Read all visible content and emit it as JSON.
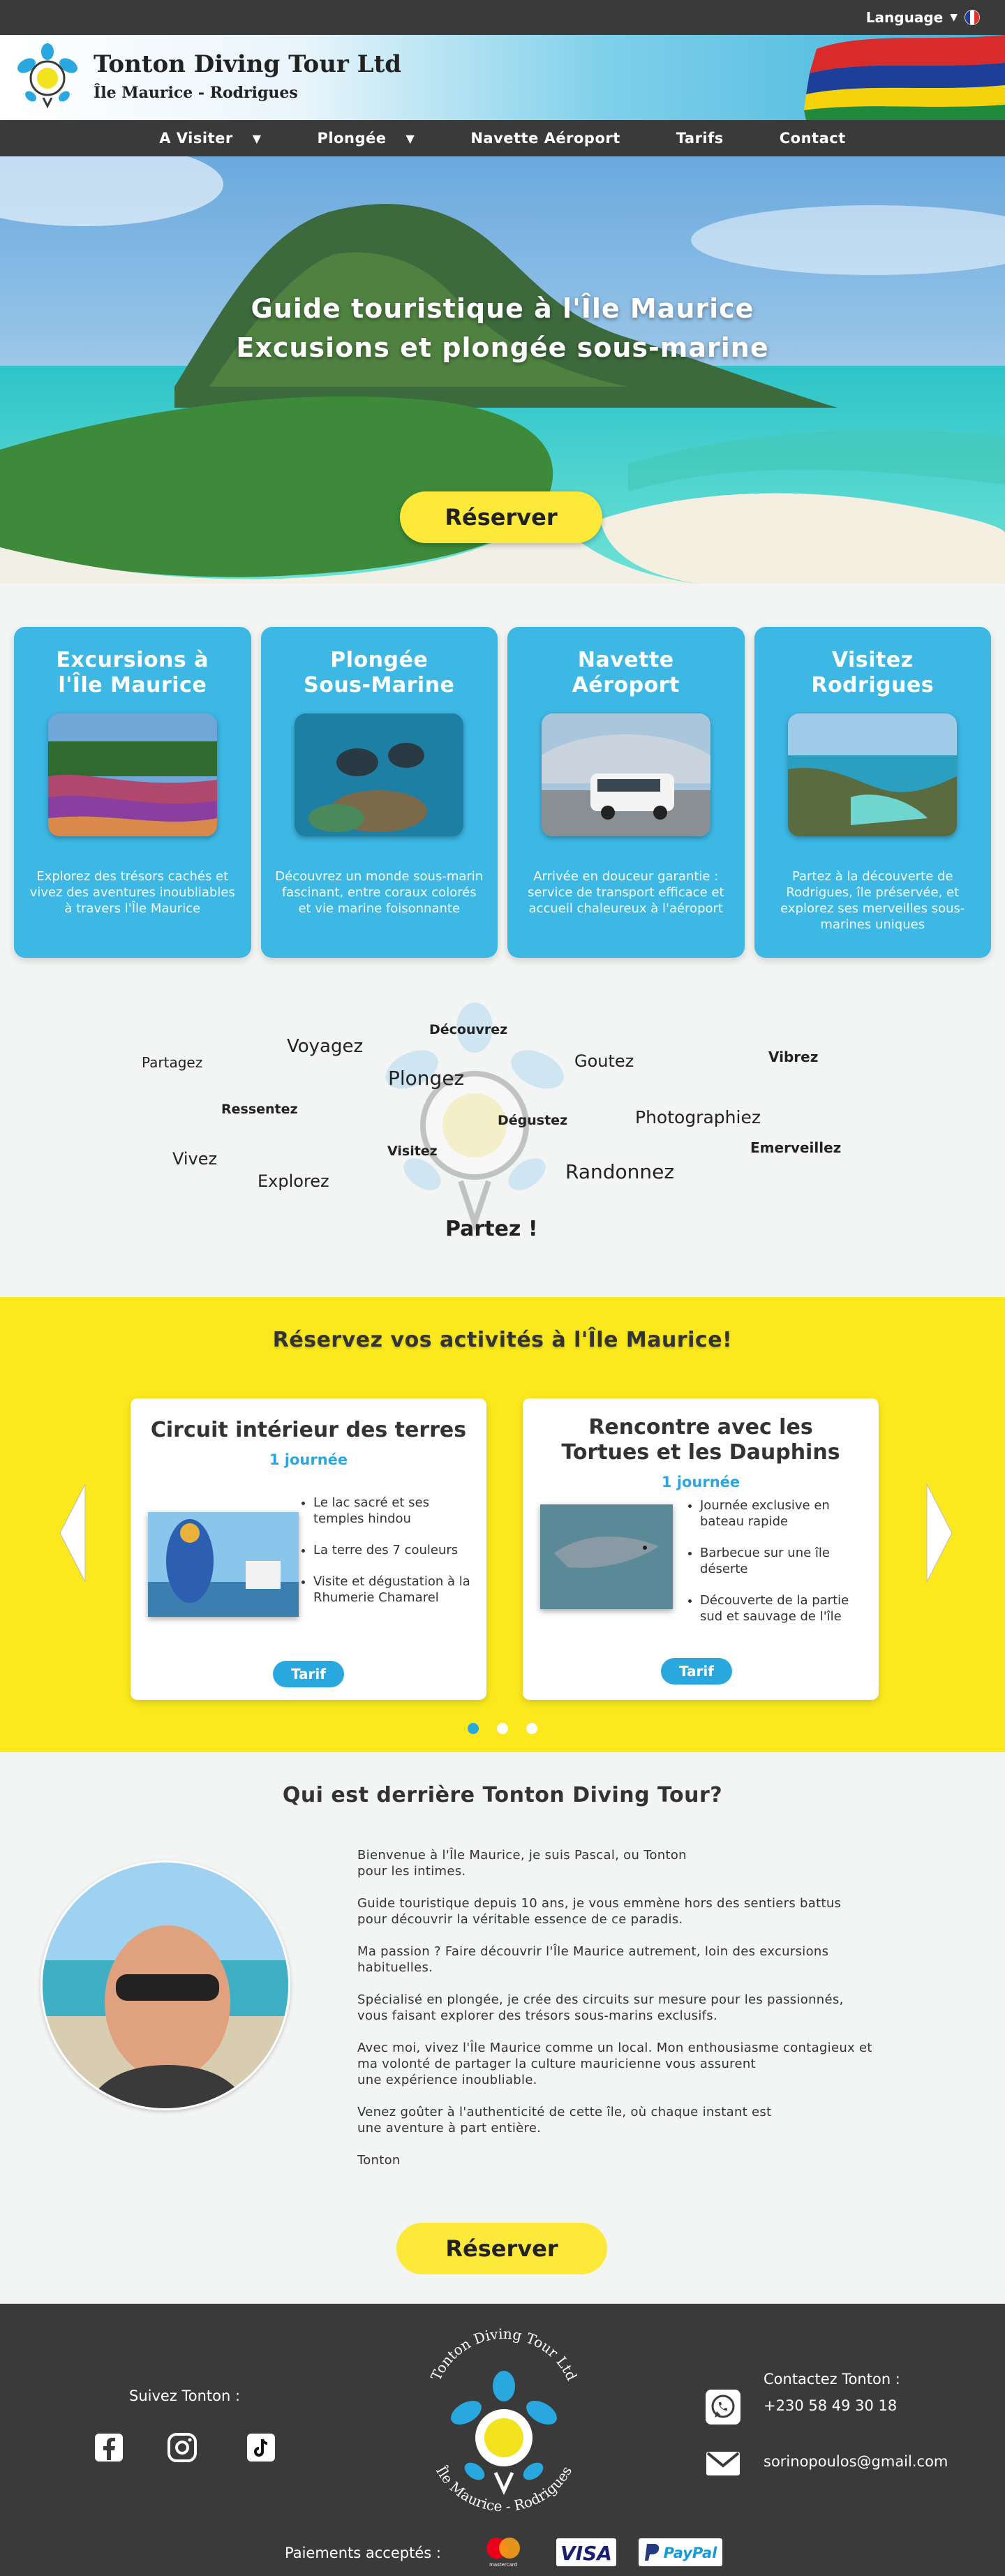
{
  "topbar": {
    "language_label": "Language",
    "language_caret": "▼"
  },
  "header": {
    "brand_title": "Tonton Diving Tour Ltd",
    "brand_subtitle": "Île Maurice - Rodrigues"
  },
  "nav": [
    {
      "label": "A Visiter",
      "caret": "▼"
    },
    {
      "label": "Plongée",
      "caret": "▼"
    },
    {
      "label": "Navette Aéroport",
      "caret": ""
    },
    {
      "label": "Tarifs",
      "caret": ""
    },
    {
      "label": "Contact",
      "caret": ""
    }
  ],
  "hero": {
    "title_line1": "Guide touristique à l'Île Maurice",
    "title_line2": "Excusions et plongée sous-marine",
    "cta": "Réserver"
  },
  "features": [
    {
      "title": "Excursions à l'Île Maurice",
      "text": "Explorez des trésors cachés et vivez des aventures inoubliables à travers l'Île Maurice"
    },
    {
      "title": "Plongée Sous-Marine",
      "text": "Découvrez un monde sous-marin fascinant, entre coraux colorés et vie marine foisonnante"
    },
    {
      "title": "Navette Aéroport",
      "text": "Arrivée en douceur garantie : service de transport efficace et accueil chaleureux à l'aéroport"
    },
    {
      "title": "Visitez Rodrigues",
      "text": "Partez à la découverte de Rodrigues, île préservée, et explorez ses merveilles sous-marines uniques"
    }
  ],
  "word_cloud": {
    "words": [
      "Partagez",
      "Voyagez",
      "Découvrez",
      "Plongez",
      "Goutez",
      "Vibrez",
      "Ressentez",
      "Dégustez",
      "Photographiez",
      "Vivez",
      "Visitez",
      "Explorez",
      "Randonnez",
      "Emerveillez"
    ],
    "closing": "Partez !"
  },
  "activities": {
    "heading": "Réservez vos activités à l'Île Maurice!",
    "cards": [
      {
        "title": "Circuit intérieur des terres",
        "duration": "1 journée",
        "items": [
          "Le lac sacré et ses temples hindou",
          "La terre des 7 couleurs",
          "Visite et dégustation à la Rhumerie Chamarel"
        ],
        "button": "Tarif"
      },
      {
        "title": "Rencontre avec les Tortues et les Dauphins",
        "duration": "1 journée",
        "items": [
          "Journée exclusive en bateau rapide",
          "Barbecue sur une île déserte",
          "Découverte de la partie sud et sauvage de l'île"
        ],
        "button": "Tarif"
      }
    ],
    "slide_count": 3,
    "active_slide": 1
  },
  "about": {
    "heading": "Qui est derrière Tonton Diving Tour?",
    "paragraphs": [
      "Bienvenue à l'Île Maurice, je suis Pascal, ou Tonton\npour les intimes.",
      "Guide touristique depuis 10 ans, je vous emmène hors des sentiers battus\npour découvrir la véritable essence de ce paradis.",
      "Ma passion ? Faire découvrir l'Île Maurice autrement, loin des excursions\nhabituelles.",
      "Spécialisé en plongée, je crée des circuits sur mesure pour les passionnés,\nvous faisant explorer des trésors sous-marins exclusifs.",
      "Avec moi, vivez l'Île Maurice comme un local. Mon enthousiasme contagieux et\nma volonté de partager la culture mauricienne vous assurent\nune expérience inoubliable.",
      "Venez goûter à l'authenticité de cette île, où chaque instant est\nune aventure à part entière.",
      "Tonton"
    ],
    "cta": "Réserver"
  },
  "footer": {
    "follow_label": "Suivez Tonton :",
    "social_icons": [
      "facebook-icon",
      "instagram-icon",
      "tiktok-icon"
    ],
    "contact_label": "Contactez Tonton :",
    "phone": "+230 58 49 30 18",
    "email": "sorinopoulos@gmail.com",
    "payments_label": "Paiements acceptés :",
    "payment_methods": {
      "mastercard": "mastercard",
      "visa": "VISA",
      "paypal": "PayPal"
    },
    "logo_text_top": "Tonton Diving Tour Ltd",
    "logo_text_bottom": "Île Maurice - Rodrigues"
  },
  "colors": {
    "dark": "#3a3a3a",
    "blue": "#3db8e5",
    "accent_blue": "#29a8df",
    "yellow": "#fbe91e",
    "button_yellow": "#fde93a"
  }
}
